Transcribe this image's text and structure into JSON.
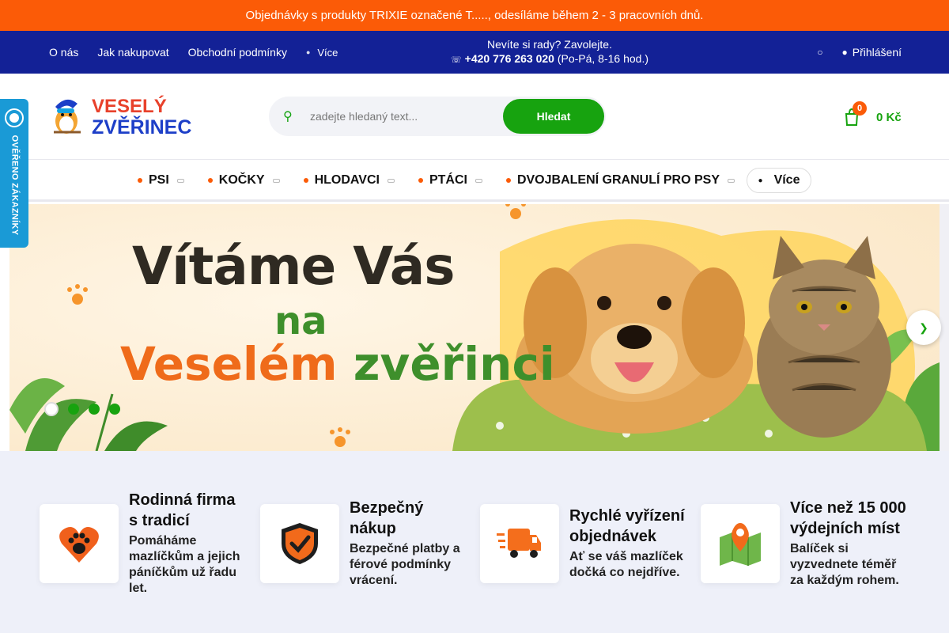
{
  "announcement": "Objednávky s produkty TRIXIE označené T....., odesíláme během 2 - 3 pracovních dnů.",
  "nav": {
    "links": [
      "O nás",
      "Jak nakupovat",
      "Obchodní podmínky"
    ],
    "more_label": "Více",
    "help_line": "Nevíte si rady? Zavolejte.",
    "phone": "+420 776 263 020",
    "hours": "(Po-Pá, 8-16 hod.)",
    "login_label": "Přihlášení"
  },
  "logo": {
    "line1": "VESELÝ",
    "line2": "ZVĚŘINEC"
  },
  "search": {
    "placeholder": "zadejte hledaný text...",
    "button_label": "Hledat"
  },
  "cart": {
    "count": "0",
    "total": "0 Kč"
  },
  "categories": {
    "items": [
      "PSI",
      "KOČKY",
      "HLODAVCI",
      "PTÁCI",
      "DVOJBALENÍ GRANULÍ PRO PSY"
    ],
    "more_label": "Více"
  },
  "trust_badge": "OVĚŘENO ZÁKAZNÍKY",
  "banner": {
    "line1": "Vítáme Vás",
    "line2": "na",
    "line3a": "Veselém",
    "line3b": "zvěřinci",
    "slide_count": 4,
    "active_slide": 1
  },
  "features": [
    {
      "title": "Rodinná firma s tradicí",
      "desc": "Pomáháme mazlíčkům a jejich páníčkům už řadu let.",
      "icon": "paw-heart-icon"
    },
    {
      "title": "Bezpečný nákup",
      "desc": "Bezpečné platby a férové podmínky vrácení.",
      "icon": "shield-check-icon"
    },
    {
      "title": "Rychlé vyřízení objednávek",
      "desc": "Ať se váš mazlíček dočká co nejdříve.",
      "icon": "delivery-truck-icon"
    },
    {
      "title": "Více než 15 000 výdejních míst",
      "desc": "Balíček si vyzvednete téměř za každým rohem.",
      "icon": "map-pin-icon"
    }
  ],
  "colors": {
    "orange": "#fb5b07",
    "navy": "#132196",
    "green": "#17a30f",
    "feature_bg": "#eef0f9"
  }
}
